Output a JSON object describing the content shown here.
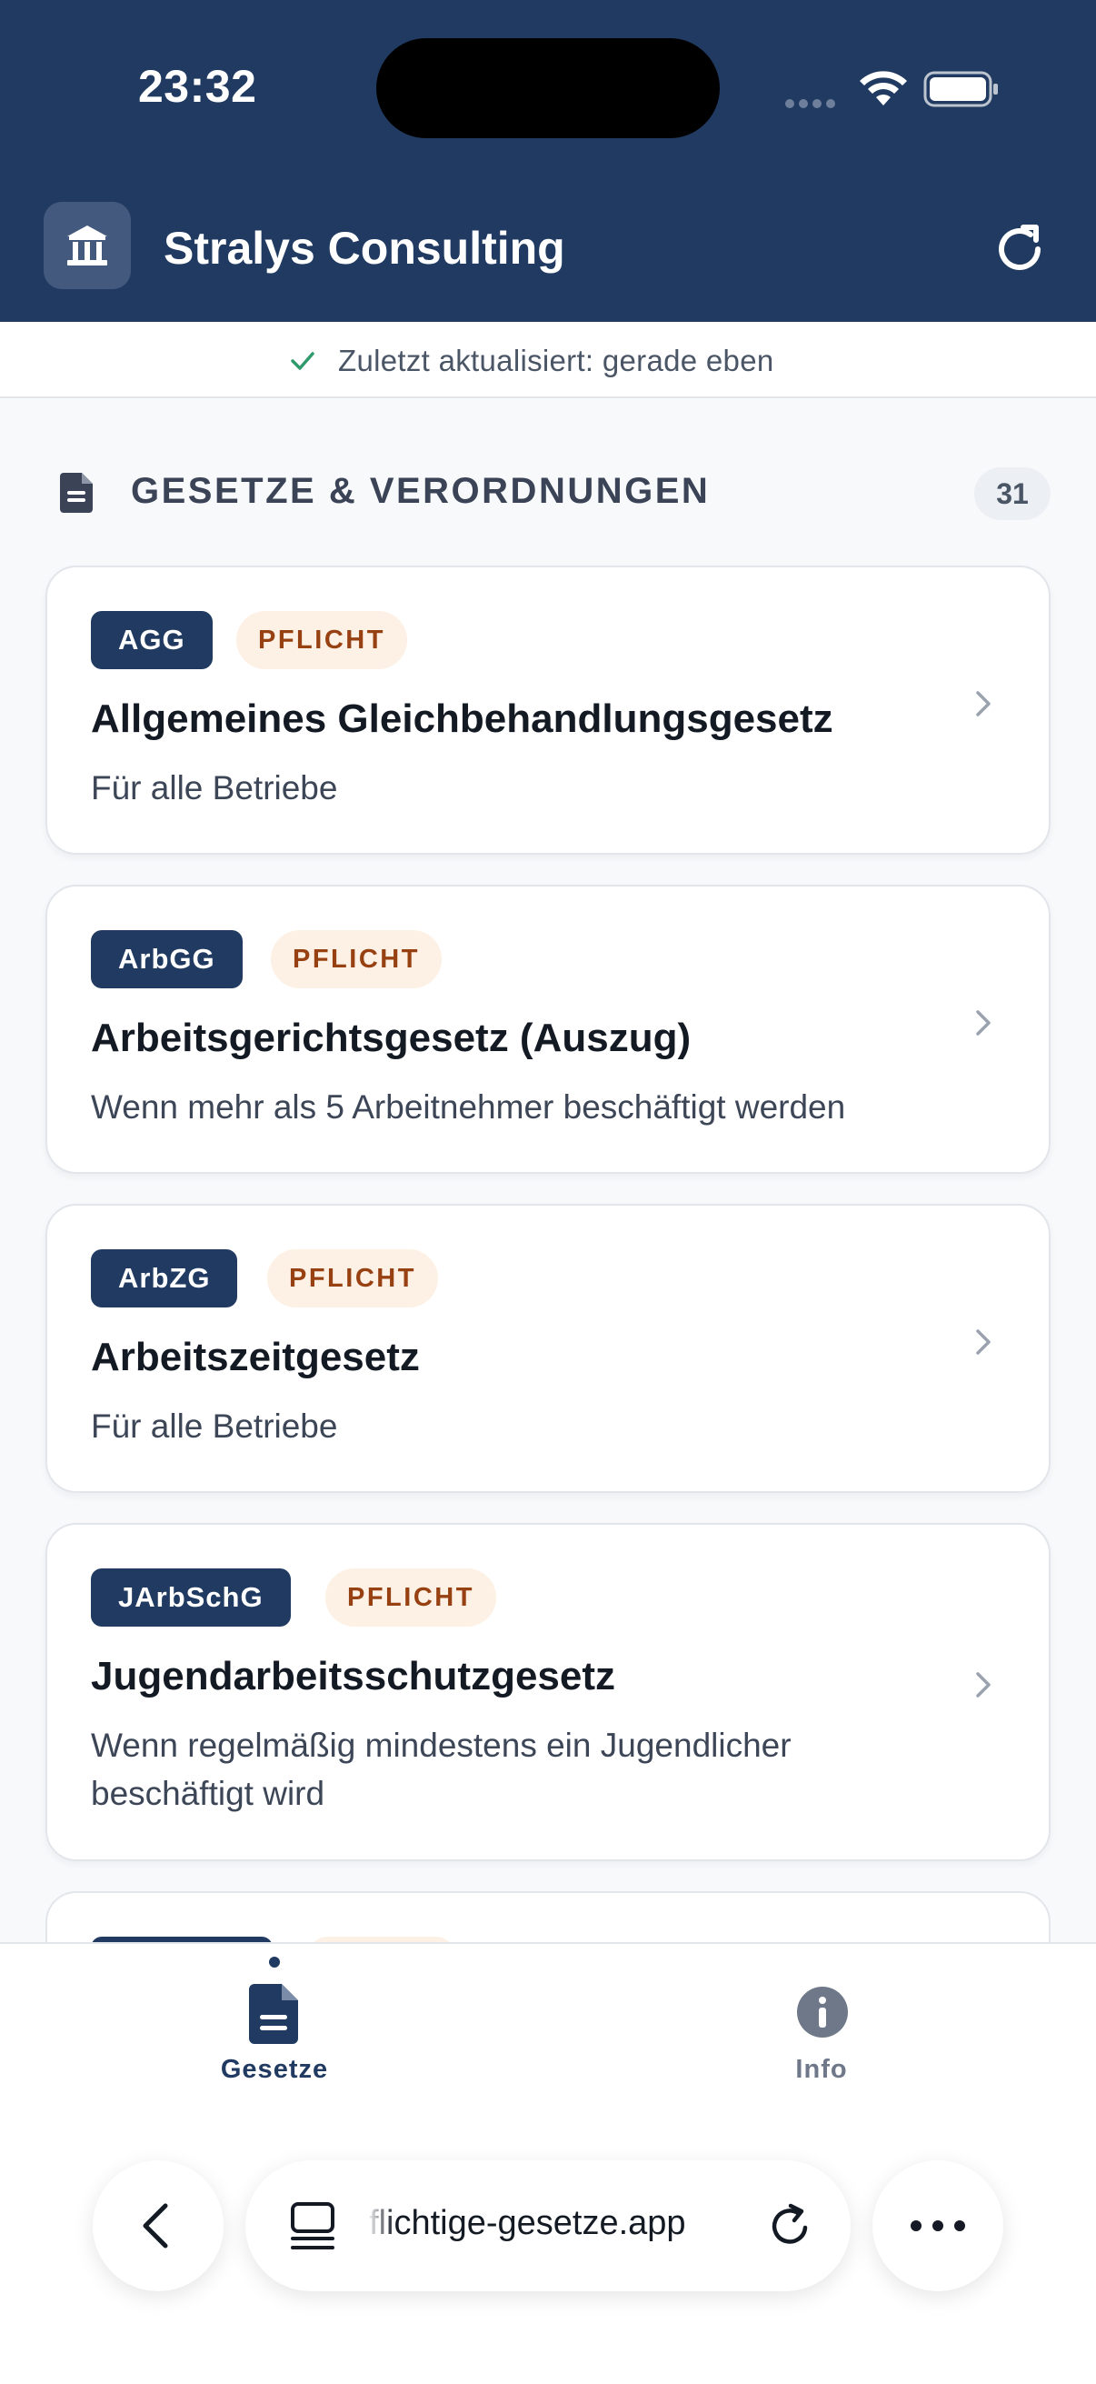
{
  "status_bar": {
    "time": "23:32"
  },
  "header": {
    "app_title": "Stralys Consulting"
  },
  "update_bar": {
    "text": "Zuletzt aktualisiert: gerade eben"
  },
  "section": {
    "title": "GESETZE & VERORDNUNGEN",
    "count": "31"
  },
  "cards": [
    {
      "abbr": "AGG",
      "tag": "PFLICHT",
      "title": "Allgemeines Gleichbehandlungsgesetz",
      "desc": "Für alle Betriebe"
    },
    {
      "abbr": "ArbGG",
      "tag": "PFLICHT",
      "title": "Arbeitsgerichtsgesetz (Auszug)",
      "desc": "Wenn mehr als 5 Arbeitnehmer beschäftigt werden"
    },
    {
      "abbr": "ArbZG",
      "tag": "PFLICHT",
      "title": "Arbeitszeitgesetz",
      "desc": "Für alle Betriebe"
    },
    {
      "abbr": "JArbSchG",
      "tag": "PFLICHT",
      "title": "Jugendarbeitsschutzgesetz",
      "desc": "Wenn regelmäßig mindestens ein Jugendlicher beschäftigt wird"
    }
  ],
  "bottom_nav": {
    "items": [
      {
        "label": "Gesetze",
        "icon": "document-icon",
        "active": true
      },
      {
        "label": "Info",
        "icon": "info-icon",
        "active": false
      }
    ]
  },
  "browser": {
    "url": "flichtige-gesetze.app"
  },
  "colors": {
    "primary": "#203a61",
    "pflicht_bg": "#fdf0e4",
    "pflicht_text": "#974112",
    "check": "#2f9a6b"
  }
}
